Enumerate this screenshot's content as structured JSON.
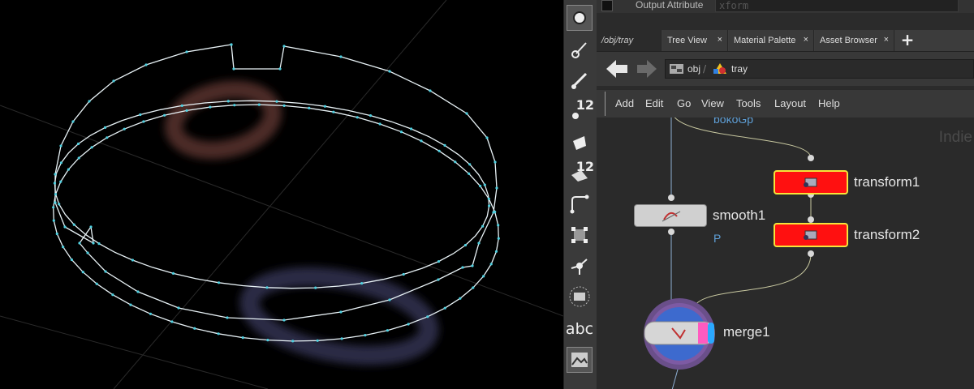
{
  "output_attribute": {
    "label": "Output Attribute",
    "value": "xform"
  },
  "tabs": [
    {
      "label": "/obj/tray",
      "active": true
    },
    {
      "label": "Tree View",
      "close": "×"
    },
    {
      "label": "Material Palette",
      "close": "×"
    },
    {
      "label": "Asset Browser",
      "close": "×"
    }
  ],
  "add_tab": "+",
  "breadcrumb": [
    {
      "label": "obj"
    },
    {
      "label": "tray"
    }
  ],
  "menu": [
    "Add",
    "Edit",
    "Go",
    "View",
    "Tools",
    "Layout",
    "Help"
  ],
  "toolshelf": {
    "badge_a": "12",
    "badge_b": "12",
    "text_tool": "abc"
  },
  "network": {
    "partial_label": "bokoGp",
    "watermark": "Indie",
    "nodes": {
      "smooth": {
        "name": "smooth1",
        "flag": "P"
      },
      "transform1": {
        "name": "transform1"
      },
      "transform2": {
        "name": "transform2"
      },
      "merge": {
        "name": "merge1"
      }
    }
  },
  "colors": {
    "curve": "#e9f3f7",
    "points": "#4fd0e0",
    "transform_node": "#ff1010",
    "selection_outline": "#f6e43a",
    "wire": "#8fb0d4"
  }
}
